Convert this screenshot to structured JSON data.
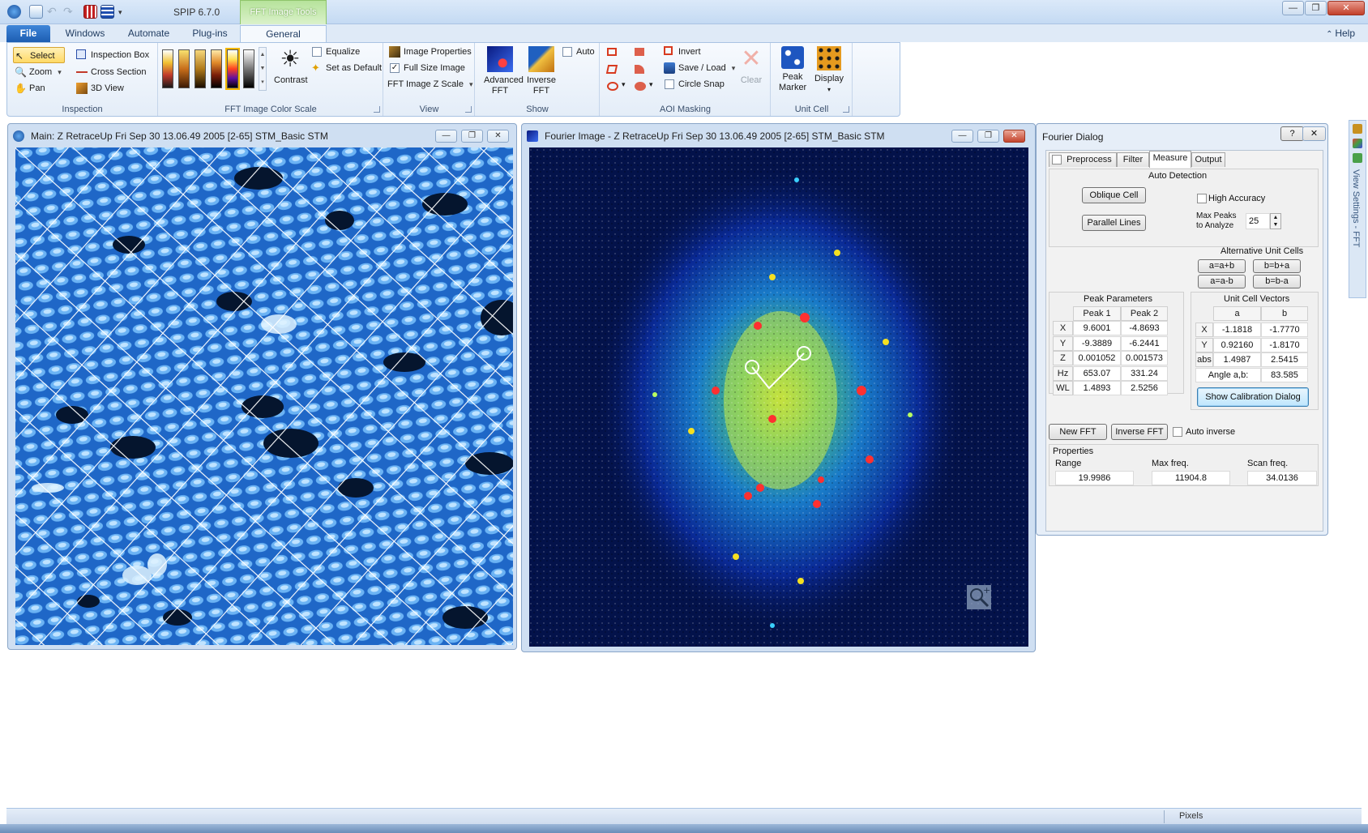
{
  "app": {
    "title": "SPIP 6.7.0",
    "context_tab": "FFT Image Tools",
    "help": "Help"
  },
  "window_controls": {
    "minimize": "—",
    "restore": "❐",
    "close": "✕"
  },
  "tabs": {
    "file": "File",
    "windows": "Windows",
    "automate": "Automate",
    "plugins": "Plug-ins",
    "general": "General"
  },
  "ribbon": {
    "inspection": {
      "label": "Inspection",
      "select": "Select",
      "zoom": "Zoom",
      "pan": "Pan",
      "inspection_box": "Inspection Box",
      "cross_section": "Cross Section",
      "view3d": "3D View"
    },
    "colorscale": {
      "label": "FFT Image Color Scale",
      "contrast": "Contrast",
      "equalize": "Equalize",
      "set_default": "Set as Default"
    },
    "view": {
      "label": "View",
      "image_properties": "Image Properties",
      "full_size": "Full Size Image",
      "fft_z_scale": "FFT Image Z Scale"
    },
    "show": {
      "label": "Show",
      "advanced_fft": "Advanced FFT",
      "inverse_fft": "Inverse FFT",
      "auto": "Auto"
    },
    "aoi": {
      "label": "AOI Masking",
      "invert": "Invert",
      "save_load": "Save / Load",
      "circle_snap": "Circle Snap",
      "clear": "Clear"
    },
    "unitcell": {
      "label": "Unit Cell",
      "peak_marker": "Peak Marker",
      "display": "Display"
    }
  },
  "main_window": {
    "title": "Main: Z RetraceUp Fri Sep 30 13.06.49 2005 [2-65]  STM_Basic STM"
  },
  "fourier_window": {
    "title": "Fourier Image - Z RetraceUp Fri Sep 30 13.06.49 2005 [2-65]  STM_Basic STM"
  },
  "dialog": {
    "title": "Fourier Dialog",
    "help_btn": "?",
    "close_btn": "✕",
    "tabs": {
      "preprocess": "Preprocess",
      "filter": "Filter",
      "measure": "Measure",
      "output": "Output"
    },
    "auto_detection": "Auto Detection",
    "oblique_cell": "Oblique Cell",
    "parallel_lines": "Parallel Lines",
    "high_accuracy": "High Accuracy",
    "max_peaks_line1": "Max Peaks",
    "max_peaks_line2": "to Analyze",
    "max_peaks_value": "25",
    "alt_cells": {
      "title": "Alternative Unit Cells",
      "b1": "a=a+b",
      "b2": "b=b+a",
      "b3": "a=a-b",
      "b4": "b=b-a"
    },
    "peak_params": {
      "title": "Peak Parameters",
      "cols": [
        "Peak 1",
        "Peak 2"
      ],
      "rows": [
        {
          "label": "X",
          "v1": "9.6001",
          "v2": "-4.8693"
        },
        {
          "label": "Y",
          "v1": "-9.3889",
          "v2": "-6.2441"
        },
        {
          "label": "Z",
          "v1": "0.001052",
          "v2": "0.001573"
        },
        {
          "label": "Hz",
          "v1": "653.07",
          "v2": "331.24"
        },
        {
          "label": "WL",
          "v1": "1.4893",
          "v2": "2.5256"
        }
      ]
    },
    "unit_cell_vectors": {
      "title": "Unit Cell Vectors",
      "cols": [
        "a",
        "b"
      ],
      "rows": [
        {
          "label": "X",
          "v1": "-1.1818",
          "v2": "-1.7770"
        },
        {
          "label": "Y",
          "v1": "0.92160",
          "v2": "-1.8170"
        },
        {
          "label": "abs",
          "v1": "1.4987",
          "v2": "2.5415"
        }
      ],
      "angle_label": "Angle a,b:",
      "angle_value": "83.585"
    },
    "show_calibration": "Show Calibration Dialog",
    "new_fft": "New FFT",
    "inverse_fft": "Inverse FFT",
    "auto_inverse": "Auto inverse",
    "properties": {
      "title": "Properties",
      "range_label": "Range",
      "range_value": "19.9986",
      "maxfreq_label": "Max freq.",
      "maxfreq_value": "11904.8",
      "scanfreq_label": "Scan freq.",
      "scanfreq_value": "34.0136"
    }
  },
  "side_panel": {
    "label": "View Settings - FFT"
  },
  "status": {
    "units": "Pixels"
  },
  "colors": {
    "ribbon_bg": "#e4edf8",
    "file_tab": "#1d5db2",
    "context_green": "#b6e39b",
    "stm_blue": "#1e6fd1",
    "fft_bg": "#03124a"
  }
}
